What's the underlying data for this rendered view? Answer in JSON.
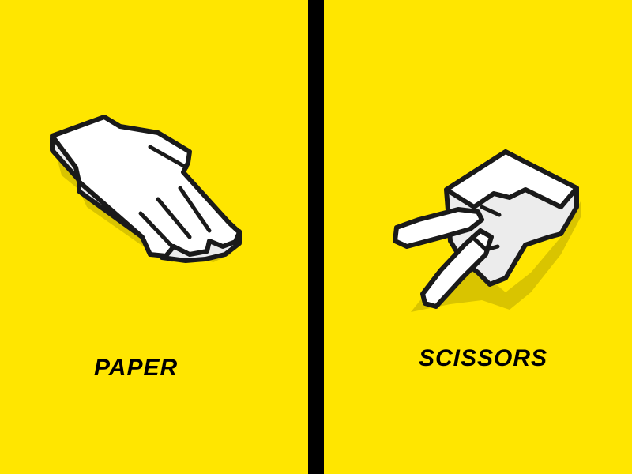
{
  "colors": {
    "background": "#ffe600",
    "divider": "#000000",
    "hand_fill": "#ffffff",
    "hand_shade": "#ececec",
    "outline": "#1a1a1a",
    "shadow": "#d9c400",
    "text": "#000000"
  },
  "panels": [
    {
      "icon": "paper-hand-icon",
      "label": "PAPER"
    },
    {
      "icon": "scissors-hand-icon",
      "label": "SCISSORS"
    }
  ]
}
